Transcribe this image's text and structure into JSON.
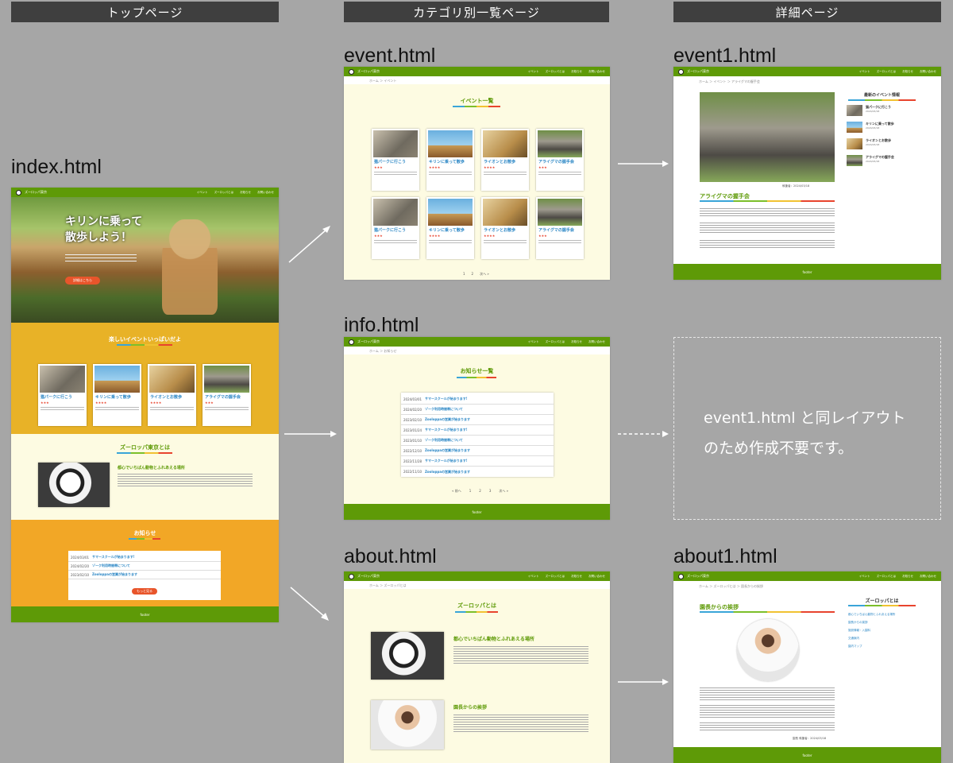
{
  "columns": [
    "トップページ",
    "カテゴリ別一覧ページ",
    "詳細ページ"
  ],
  "files": {
    "index": "index.html",
    "event": "event.html",
    "info": "info.html",
    "about": "about.html",
    "event1": "event1.html",
    "about1": "about1.html"
  },
  "site": {
    "name": "ズーロッパ東京",
    "nav": [
      "イベント",
      "ズーロッパとは",
      "お知らせ",
      "お問い合わせ"
    ],
    "footer": "footer"
  },
  "index": {
    "hero_line1": "キリンに乗って",
    "hero_line2": "散歩しよう！",
    "hero_button": "詳細はこちら",
    "events_title": "楽しいイベントいっぱいだよ",
    "about_title": "ズーロッパ東京とは",
    "about_subtitle": "都心でいちばん動物とふれあえる場所",
    "info_title": "お知らせ",
    "info_button": "もっと見る",
    "info_rows": [
      {
        "date": "2024/03/01",
        "title": "サマースクールが始まります!"
      },
      {
        "date": "2024/02/20",
        "title": "ゾーク利用時間帯について"
      },
      {
        "date": "2023/02/10",
        "title": "Zooloppaの営業が始まります"
      }
    ]
  },
  "cards": [
    {
      "title": "猫パークに行こう",
      "stars": "★★★"
    },
    {
      "title": "キリンに乗って散歩",
      "stars": "★★★★"
    },
    {
      "title": "ライオンとお散歩",
      "stars": "★★★★"
    },
    {
      "title": "アライグマの握手会",
      "stars": "★★★"
    }
  ],
  "event_page": {
    "title": "イベント一覧",
    "crumb": "ホーム ＞ イベント",
    "pagination": [
      "1",
      "2",
      "次へ »"
    ]
  },
  "info_page": {
    "title": "お知らせ一覧",
    "crumb": "ホーム ＞ お知らせ",
    "pagination": [
      "« 前へ",
      "1",
      "2",
      "3",
      "次へ »"
    ],
    "rows": [
      {
        "date": "2024/03/01",
        "title": "サマースクールが始まります!"
      },
      {
        "date": "2024/02/20",
        "title": "ゾーク利用時間帯について"
      },
      {
        "date": "2023/02/10",
        "title": "Zooloppaの営業が始まります"
      },
      {
        "date": "2023/01/24",
        "title": "サマースクールが始まります!"
      },
      {
        "date": "2023/01/10",
        "title": "ゾーク利用時間帯について"
      },
      {
        "date": "2022/12/10",
        "title": "Zooloppaの営業が始まります"
      },
      {
        "date": "2022/11/28",
        "title": "サマースクールが始まります!"
      },
      {
        "date": "2022/11/10",
        "title": "Zooloppaの営業が始まります"
      }
    ]
  },
  "about_page": {
    "title": "ズーロッパとは",
    "crumb": "ホーム ＞ ズーロッパとは",
    "section1": "都心でいちばん動物とふれあえる場所",
    "section2": "園長からの挨拶"
  },
  "event1": {
    "crumb": "ホーム ＞ イベント ＞ アライグマの握手会",
    "title": "アライグマの握手会",
    "sidebar_title": "最新のイベント情報",
    "caption": "執筆者：2024/03/18",
    "sidebar_items": [
      {
        "title": "猫パークに行こう",
        "date": "2024/03/18"
      },
      {
        "title": "キリンに乗って散歩",
        "date": "2024/03/18"
      },
      {
        "title": "ライオンとお散歩",
        "date": "2024/03/18"
      },
      {
        "title": "アライグマの握手会",
        "date": "2024/03/18"
      }
    ]
  },
  "about1": {
    "crumb": "ホーム ＞ ズーロッパとは ＞ 園長からの挨拶",
    "title": "園長からの挨拶",
    "sidebar_title": "ズーロッパとは",
    "sidebar_links": [
      "都心でいちばん動物とふれあえる場所",
      "園長からの挨拶",
      "施設情報・入園料",
      "交通案内",
      "園内マップ"
    ],
    "caption": "園長 執筆者：2024/03/18"
  },
  "note": {
    "line1": "event1.html と同レイアウト",
    "line2": "のため作成不要です。"
  }
}
